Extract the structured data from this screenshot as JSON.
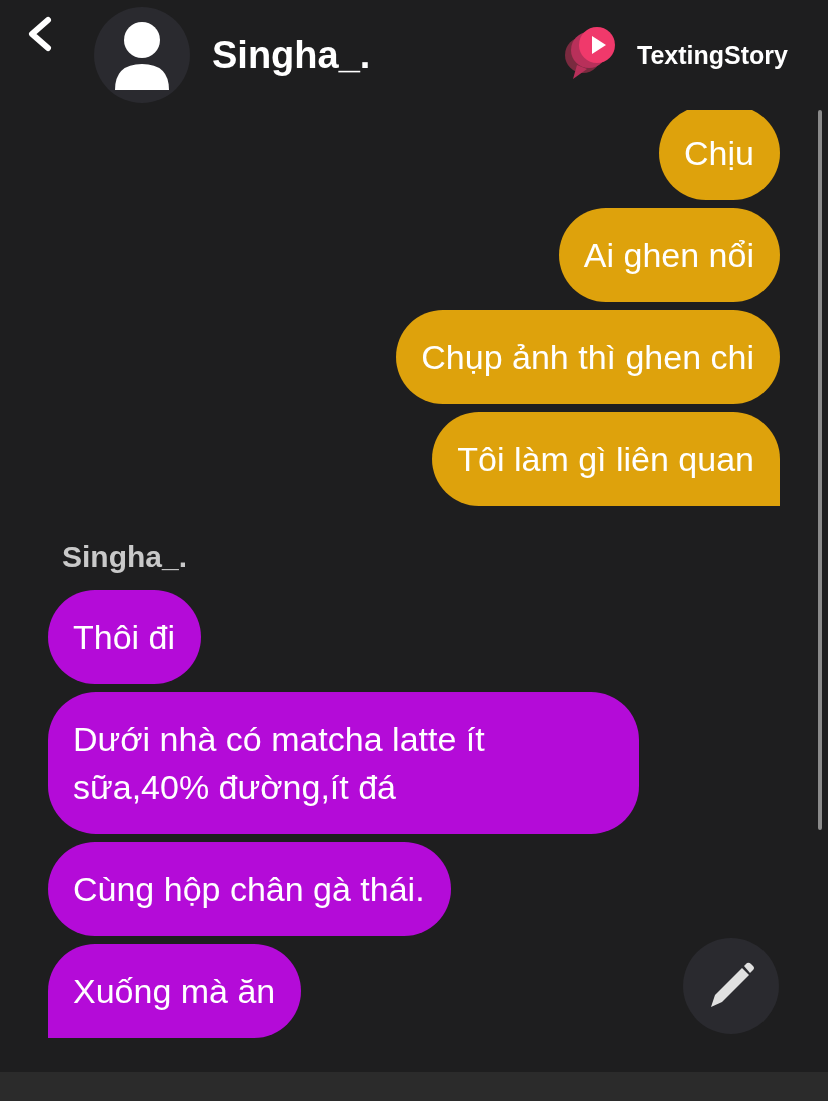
{
  "header": {
    "contact_name": "Singha_.",
    "brand": "TextingStory"
  },
  "groups": [
    {
      "kind": "sent",
      "messages": [
        "Chịu",
        "Ai ghen nổi",
        "Chụp ảnh thì ghen chi",
        "Tôi làm gì liên quan"
      ]
    },
    {
      "kind": "received",
      "sender": "Singha_.",
      "messages": [
        "Thôi đi",
        "Dưới nhà có matcha latte ít sữa,40% đường,ít đá",
        "Cùng hộp chân gà thái.",
        "Xuống mà ăn"
      ]
    }
  ]
}
